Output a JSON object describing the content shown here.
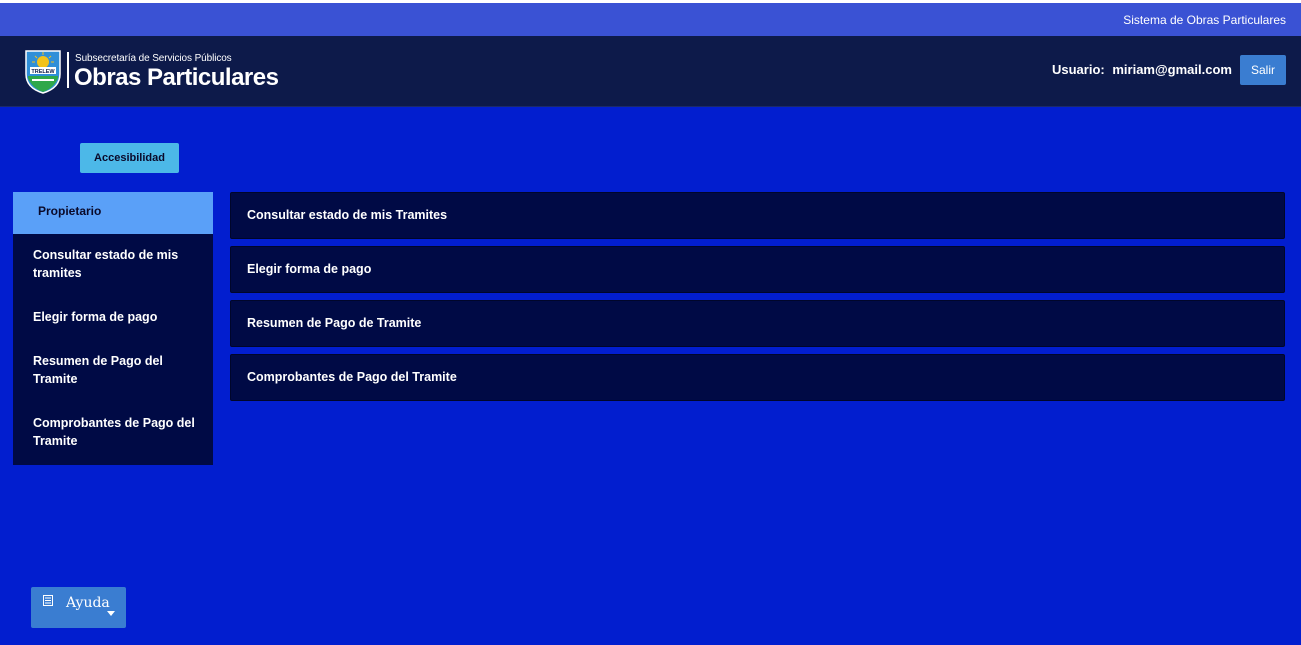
{
  "system_bar": {
    "title": "Sistema de Obras Particulares"
  },
  "header": {
    "logo": {
      "badge_text": "TRELEW",
      "subtitle": "Subsecretaría de Servicios Públicos",
      "title": "Obras Particulares"
    },
    "user_label": "Usuario:",
    "user_email": "miriam@gmail.com",
    "logout_label": "Salir"
  },
  "accessibility": {
    "label": "Accesibilidad"
  },
  "sidebar": {
    "title": "Propietario",
    "items": [
      {
        "label": "Consultar estado de mis tramites"
      },
      {
        "label": "Elegir forma de pago"
      },
      {
        "label": "Resumen de Pago del Tramite"
      },
      {
        "label": "Comprobantes de Pago del Tramite"
      }
    ]
  },
  "main": {
    "items": [
      {
        "label": "Consultar estado de mis Tramites"
      },
      {
        "label": "Elegir forma de pago"
      },
      {
        "label": "Resumen de Pago de Tramite"
      },
      {
        "label": "Comprobantes de Pago del Tramite"
      }
    ]
  },
  "help": {
    "label": "Ayuda",
    "icon": "list-icon"
  },
  "colors": {
    "page_bg": "#021ecf",
    "system_bar": "#3a52d4",
    "header_bg": "#0d1a4a",
    "panel_bg": "#000a45",
    "sidebar_active": "#5aa0f8",
    "accessibility_btn": "#4cb8e8",
    "button_blue": "#3a7dd1"
  }
}
